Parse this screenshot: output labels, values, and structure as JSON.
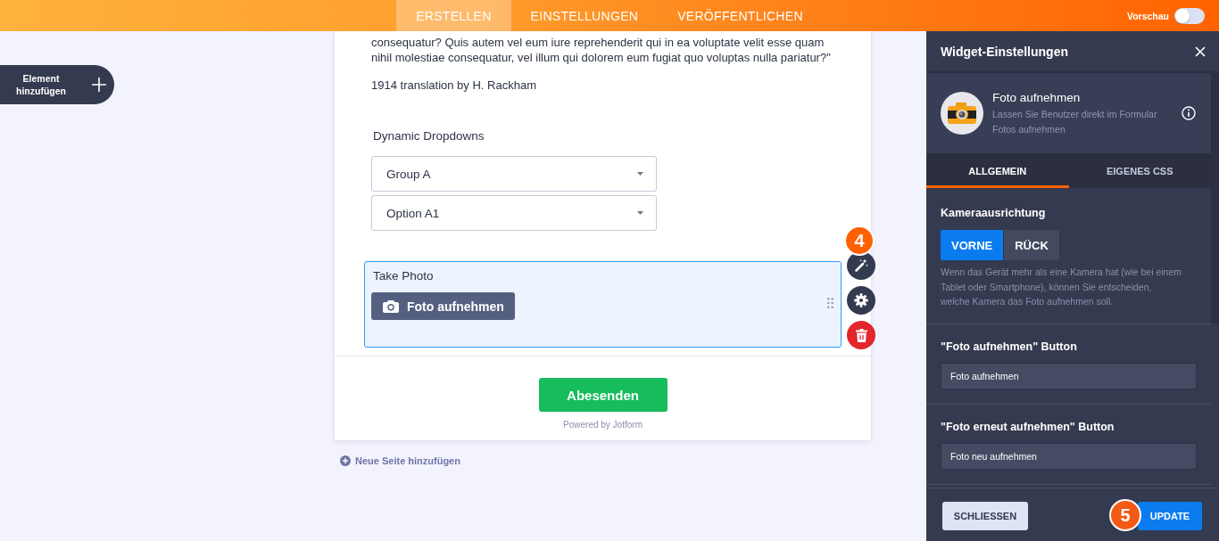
{
  "top_bar": {
    "tabs": [
      {
        "label": "ERSTELLEN",
        "selected": true
      },
      {
        "label": "EINSTELLUNGEN",
        "selected": false
      },
      {
        "label": "VERÖFFENTLICHEN",
        "selected": false
      }
    ],
    "preview": {
      "label": "Vorschau",
      "on": false
    }
  },
  "add_element": {
    "label": "Element hinzufügen"
  },
  "form": {
    "quote_lines": [
      "consequatur? Quis autem vel eum iure reprehenderit qui in ea voluptate velit esse quam",
      "nihil molestiae consequatur, vel illum qui dolorem eum fugiat quo voluptas nulla pariatur?\""
    ],
    "caption": "1914 translation by H. Rackham",
    "dropdown_group": {
      "label": "Dynamic Dropdowns",
      "dropdowns": [
        {
          "value": "Group A"
        },
        {
          "value": "Option A1"
        }
      ]
    },
    "photo_field": {
      "label": "Take Photo",
      "button": "Foto aufnehmen",
      "selected": true,
      "step_badge": "4"
    },
    "submit": "Abesenden",
    "powered_by": "Powered by Jotform"
  },
  "add_page": "Neue Seite hinzufügen",
  "settings_panel": {
    "title": "Widget-Einstellungen",
    "widget": {
      "name": "Foto aufnehmen",
      "description": "Lassen Sie Benutzer direkt im Formular Fotos aufnehmen"
    },
    "tabs": [
      {
        "label": "ALLGEMEIN",
        "selected": true
      },
      {
        "label": "EIGENES CSS",
        "selected": false
      }
    ],
    "sections": [
      {
        "kind": "segmented",
        "label": "Kameraausrichtung",
        "options": [
          {
            "label": "VORNE",
            "selected": true
          },
          {
            "label": "RÜCK",
            "selected": false
          }
        ],
        "help_lines": [
          "Wenn das Gerät mehr als eine Kamera hat (wie bei einem",
          "Tablet oder Smartphone), können Sie entscheiden,",
          "welche Kamera das Foto aufnehmen soll."
        ]
      },
      {
        "kind": "text",
        "label": "\"Foto aufnehmen\" Button",
        "value": "Foto aufnehmen"
      },
      {
        "kind": "text",
        "label": "\"Foto erneut aufnehmen\" Button",
        "value": "Foto neu aufnehmen"
      }
    ],
    "buttons": [
      {
        "kind": "secondary",
        "label": "SCHLIESSEN"
      },
      {
        "kind": "primary",
        "label": "UPDATE"
      }
    ],
    "step_badge": "5"
  }
}
